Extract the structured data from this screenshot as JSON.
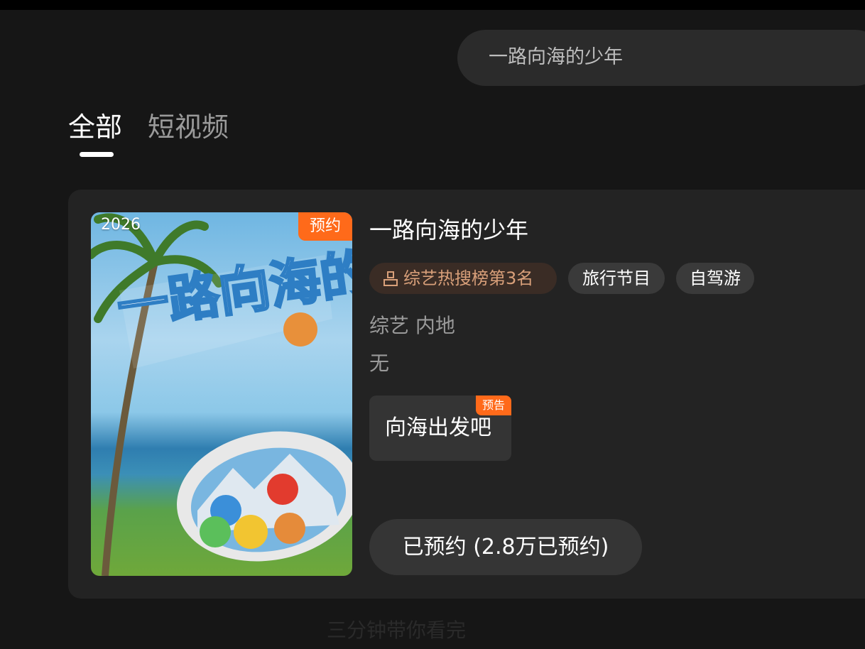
{
  "search": {
    "query": "一路向海的少年"
  },
  "tabs": [
    {
      "label": "全部",
      "active": true
    },
    {
      "label": "短视频",
      "active": false
    }
  ],
  "result": {
    "poster": {
      "year": "2026",
      "badge": "预约",
      "logo_text": "一路向海的少年"
    },
    "title": "一路向海的少年",
    "tags": [
      {
        "label": "综艺热搜榜第3名",
        "icon": "ranking-podium-icon"
      },
      {
        "label": "旅行节目"
      },
      {
        "label": "自驾游"
      }
    ],
    "category": "综艺 内地",
    "cast": "无",
    "episode": {
      "label": "向海出发吧",
      "badge": "预告"
    },
    "reserve_button": "已预约 (2.8万已预约)"
  },
  "footer_hint": "三分钟带你看完",
  "colors": {
    "background": "#161616",
    "card": "#232323",
    "accent_orange": "#ff6a1a",
    "rank_tag_bg": "#3a2c25",
    "rank_tag_text": "#d9a07a"
  }
}
